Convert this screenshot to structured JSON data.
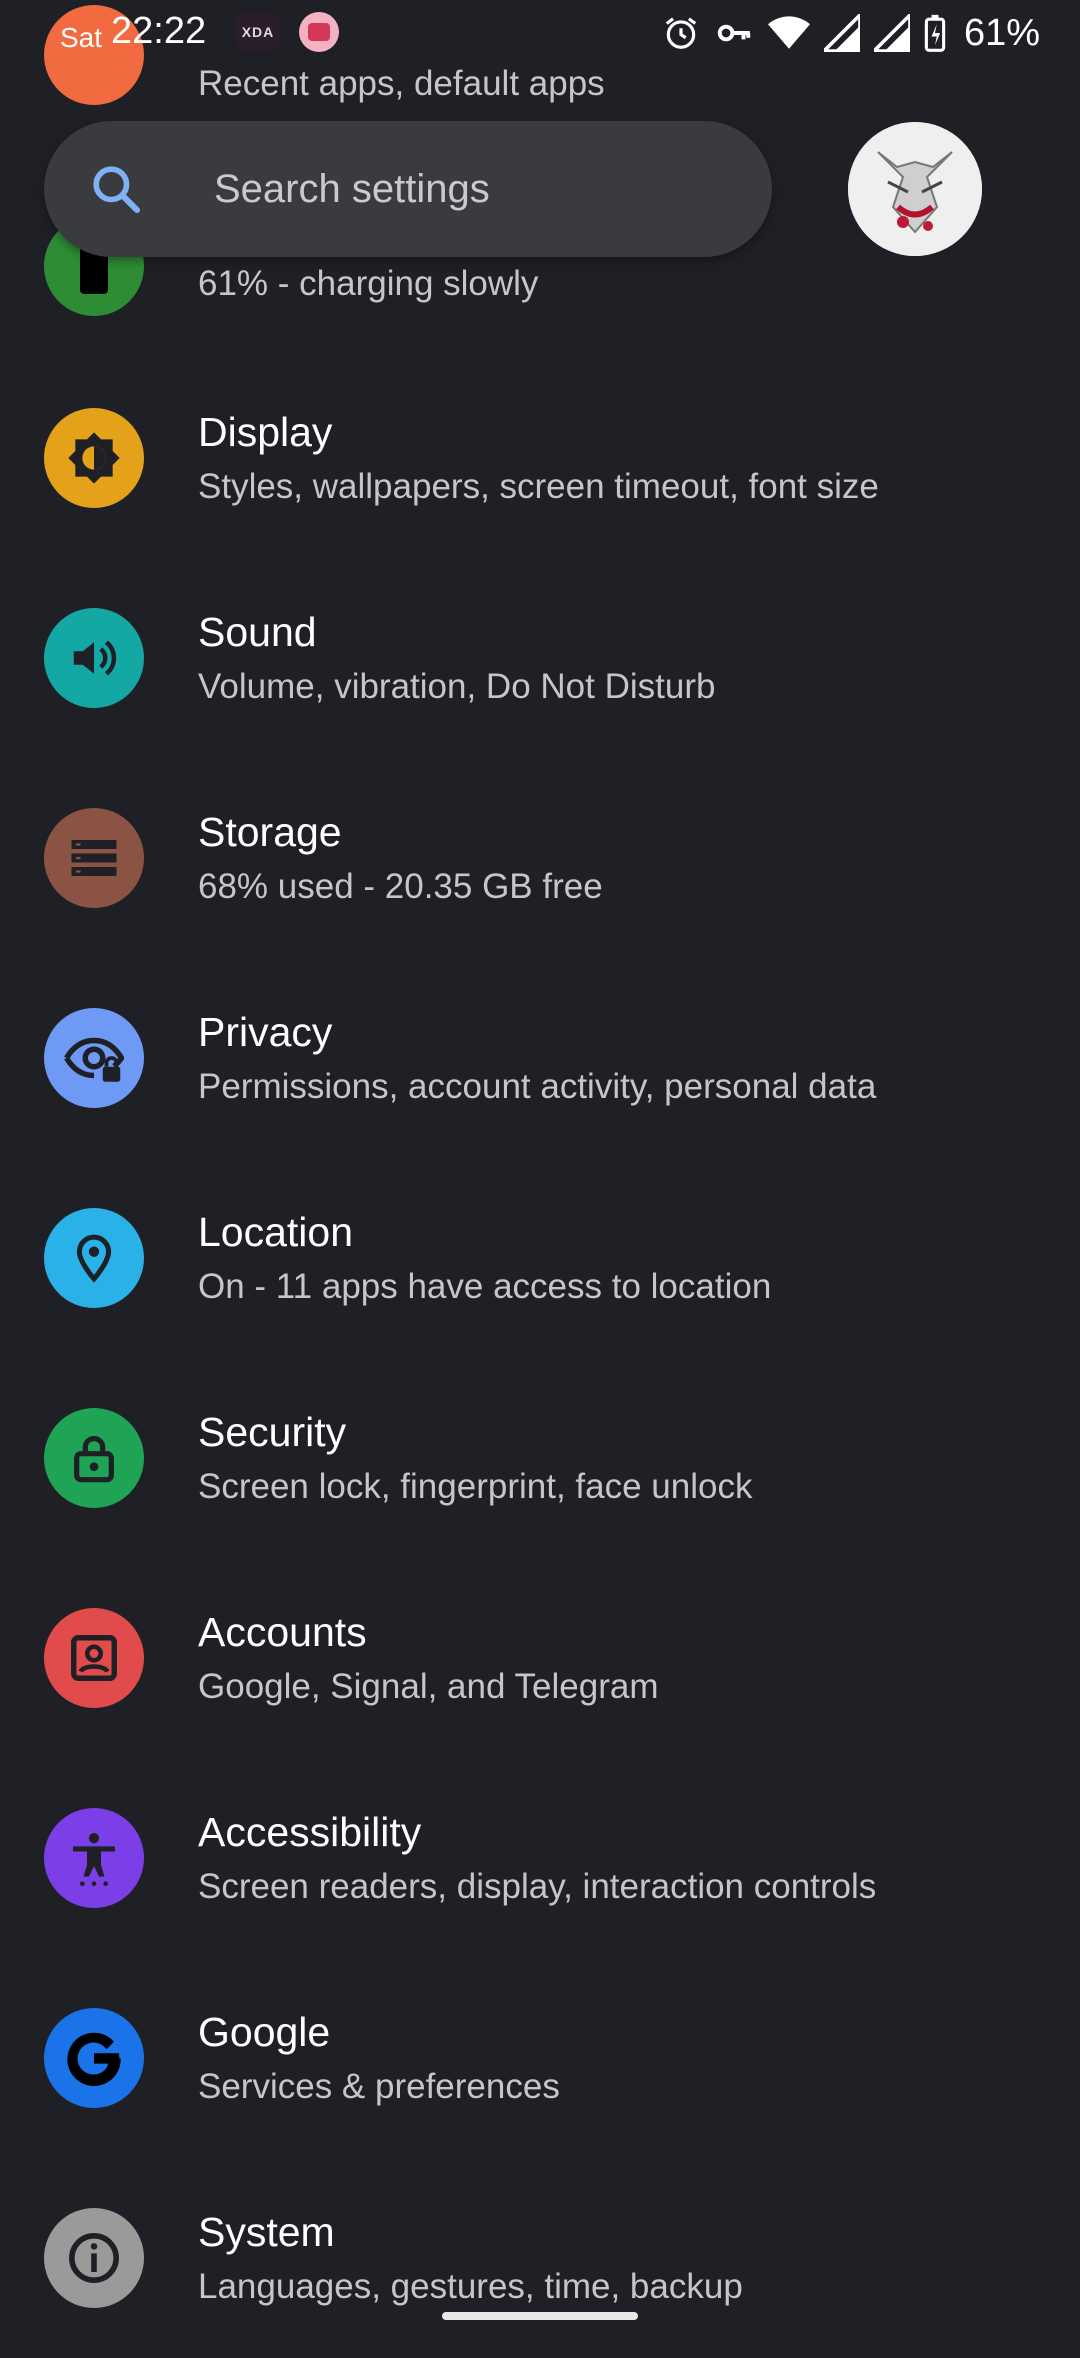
{
  "status_bar": {
    "day": "Sat",
    "time": "22:22",
    "xda_label": "XDA",
    "battery_percent": "61%"
  },
  "partial_rows": {
    "apps_subtitle": "Recent apps, default apps",
    "battery_subtitle": "61% - charging slowly"
  },
  "search": {
    "placeholder": "Search settings"
  },
  "settings": [
    {
      "title": "Display",
      "subtitle": "Styles, wallpapers, screen timeout, font size",
      "color": "#e3a21a",
      "icon": "brightness-icon"
    },
    {
      "title": "Sound",
      "subtitle": "Volume, vibration, Do Not Disturb",
      "color": "#14a8a4",
      "icon": "volume-icon"
    },
    {
      "title": "Storage",
      "subtitle": "68% used - 20.35 GB free",
      "color": "#8a5343",
      "icon": "storage-icon"
    },
    {
      "title": "Privacy",
      "subtitle": "Permissions, account activity, personal data",
      "color": "#6e9af5",
      "icon": "privacy-eye-icon"
    },
    {
      "title": "Location",
      "subtitle": "On - 11 apps have access to location",
      "color": "#29b1e8",
      "icon": "location-pin-icon"
    },
    {
      "title": "Security",
      "subtitle": "Screen lock, fingerprint, face unlock",
      "color": "#1fa355",
      "icon": "lock-icon"
    },
    {
      "title": "Accounts",
      "subtitle": "Google, Signal, and Telegram",
      "color": "#e24b4b",
      "icon": "account-icon"
    },
    {
      "title": "Accessibility",
      "subtitle": "Screen readers, display, interaction controls",
      "color": "#7c3ee6",
      "icon": "accessibility-icon"
    },
    {
      "title": "Google",
      "subtitle": "Services & preferences",
      "color": "#1a73e8",
      "icon": "google-g-icon"
    },
    {
      "title": "System",
      "subtitle": "Languages, gestures, time, backup",
      "color": "#9a9a9a",
      "icon": "info-icon"
    }
  ]
}
